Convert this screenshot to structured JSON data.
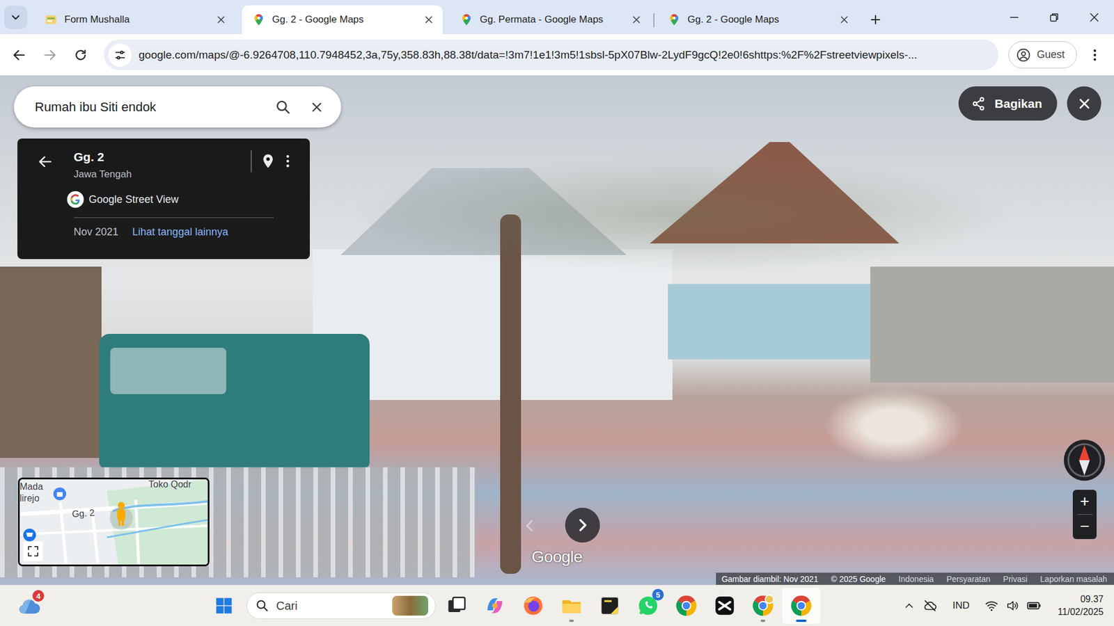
{
  "browser": {
    "tabs": [
      {
        "label": "Form Mushalla",
        "selected": false,
        "kind": "form"
      },
      {
        "label": "Gg. 2 - Google Maps",
        "selected": true,
        "kind": "maps"
      },
      {
        "label": "Gg. Permata - Google Maps",
        "selected": false,
        "kind": "maps"
      },
      {
        "label": "Gg. 2 - Google Maps",
        "selected": false,
        "kind": "maps"
      }
    ],
    "url": "google.com/maps/@-6.9264708,110.7948452,3a,75y,358.83h,88.38t/data=!3m7!1e1!3m5!1sbsl-5pX07Blw-2LydF9gcQ!2e0!6shttps:%2F%2Fstreetviewpixels-...",
    "profile": "Guest"
  },
  "maps": {
    "search": {
      "value": "Rumah ibu Siti endok"
    },
    "place_card": {
      "title": "Gg. 2",
      "subtitle": "Jawa Tengah",
      "source": "Google Street View",
      "date": "Nov 2021",
      "link": "Lihat tanggal lainnya"
    },
    "share_button": "Bagikan",
    "minimap": {
      "labels": [
        "Mada",
        "lirejo",
        "Gg. 2",
        "Toko Qodr"
      ]
    },
    "zoom": {
      "in": "+",
      "out": "−"
    },
    "watermark": "Google",
    "footer": [
      "Gambar diambil: Nov 2021",
      "© 2025 Google",
      "Indonesia",
      "Persyaratan",
      "Privasi",
      "Laporkan masalah"
    ]
  },
  "taskbar": {
    "weather_badge": "4",
    "search_placeholder": "Cari",
    "apps": [
      {
        "kind": "taskview",
        "running": false,
        "selected": false
      },
      {
        "kind": "copilot",
        "running": false,
        "selected": false
      },
      {
        "kind": "firefox",
        "running": false,
        "selected": false
      },
      {
        "kind": "explorer",
        "running": true,
        "selected": false
      },
      {
        "kind": "sticky",
        "running": false,
        "selected": false
      },
      {
        "kind": "whatsapp",
        "running": false,
        "selected": false,
        "badge": "5"
      },
      {
        "kind": "chrome",
        "running": false,
        "selected": false
      },
      {
        "kind": "capcut",
        "running": false,
        "selected": false
      },
      {
        "kind": "chrome-profile",
        "running": true,
        "selected": false
      },
      {
        "kind": "chrome",
        "running": true,
        "selected": true
      }
    ],
    "tray": {
      "language": "IND",
      "time": "09.37",
      "date": "11/02/2025"
    }
  }
}
